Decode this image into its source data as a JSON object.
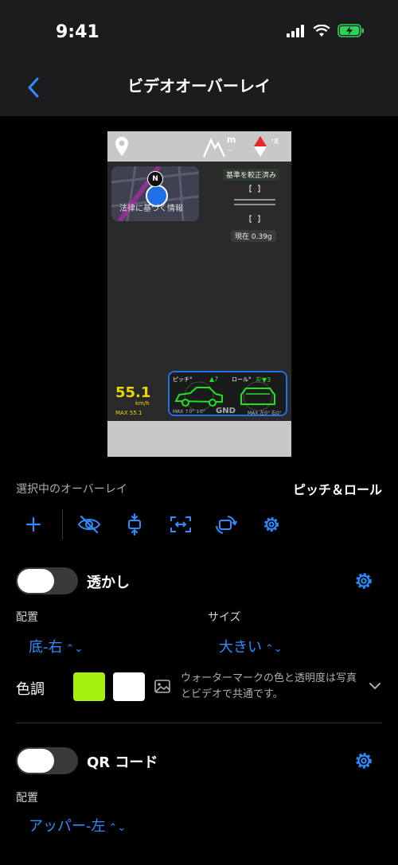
{
  "status": {
    "time": "9:41"
  },
  "nav": {
    "title": "ビデオオーバーレイ"
  },
  "preview": {
    "map_caption": "法律に基づく情報",
    "compass_label": "N",
    "altitude_unit": "m",
    "altitude_value": "---",
    "heading_label": "°真",
    "calibrated_badge": "基準を較正済み",
    "gforce_now": "現在 0.39g",
    "speed_value": "55.1",
    "speed_unit": "km/h",
    "speed_max": "MAX 55.1",
    "pitch_label": "ピッチ°",
    "pitch_value": "▲7",
    "roll_label": "ロール°",
    "roll_value": "左▼3",
    "pitch_max": "MAX ↑0° ↓0°",
    "roll_max": "MAX 左0° 右0°",
    "gnd_label": "GND",
    "accent_green": "#22e022",
    "accent_blue": "#1f6fe8",
    "speed_color": "#e8d800"
  },
  "selected": {
    "label": "選択中のオーバーレイ",
    "value": "ピッチ＆ロール"
  },
  "toolbar": {
    "icons": [
      "plus-icon",
      "eye-slash-icon",
      "align-vertical-icon",
      "resize-icon",
      "rotate-icon",
      "gear-icon"
    ]
  },
  "watermark": {
    "title": "透かし",
    "placement_label": "配置",
    "placement_value": "底-右",
    "size_label": "サイズ",
    "size_value": "大きい",
    "tone_label": "色調",
    "tone_color_1": "#a6f20e",
    "tone_color_2": "#ffffff",
    "note": "ウォーターマークの色と透明度は写真とビデオで共通です。",
    "enabled": false
  },
  "qr": {
    "title": "QR コード",
    "placement_label": "配置",
    "placement_value": "アッパー-左",
    "enabled": false
  },
  "colors": {
    "accent": "#2f8cff",
    "background": "#000000",
    "bar": "#1c1c1e"
  }
}
